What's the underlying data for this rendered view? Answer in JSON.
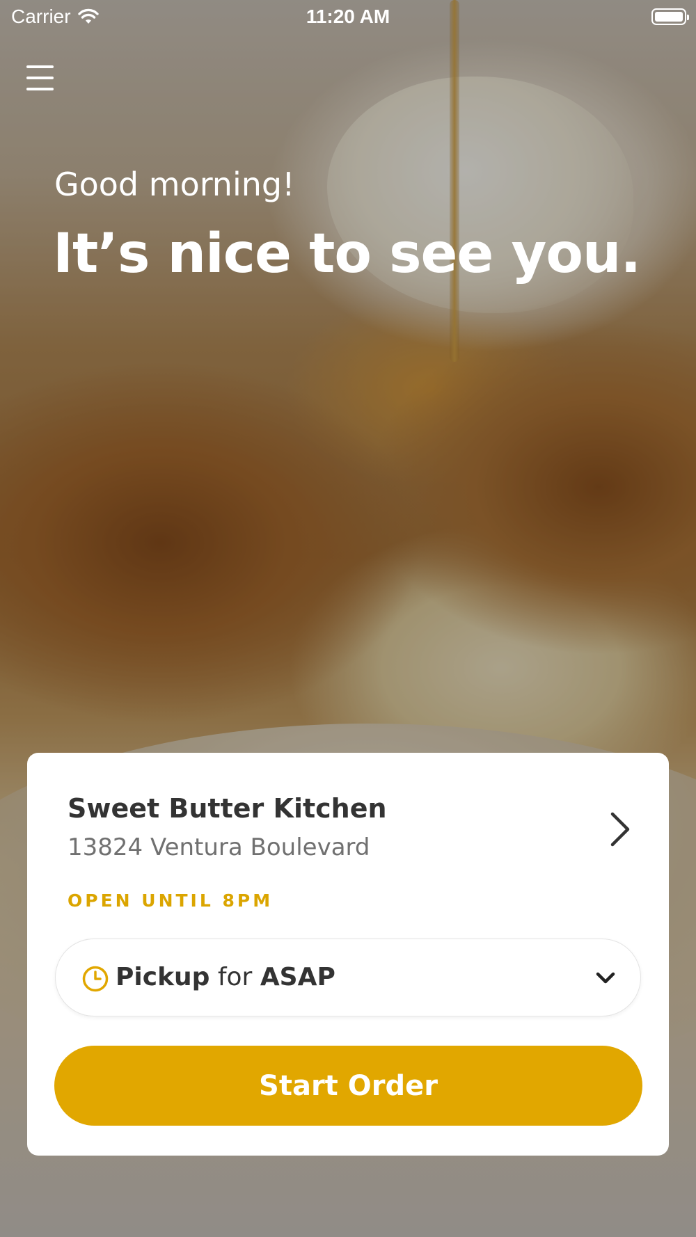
{
  "status_bar": {
    "carrier": "Carrier",
    "time": "11:20 AM"
  },
  "icons": {
    "menu": "hamburger-menu-icon",
    "wifi": "wifi-icon",
    "battery": "battery-icon",
    "clock": "clock-icon",
    "chevron_right": "chevron-right-icon",
    "chevron_down": "chevron-down-icon"
  },
  "hero": {
    "greeting": "Good morning!",
    "headline": "It’s nice to see you."
  },
  "card": {
    "restaurant_name": "Sweet Butter Kitchen",
    "restaurant_address": "13824 Ventura Boulevard",
    "hours": "OPEN UNTIL 8PM",
    "order_mode": {
      "method": "Pickup",
      "connector": "for",
      "time": "ASAP"
    },
    "start_order_label": "Start Order"
  },
  "colors": {
    "accent": "#E1A700",
    "hours_text": "#DBA500",
    "text_dark": "#333333",
    "text_muted": "#707070"
  }
}
